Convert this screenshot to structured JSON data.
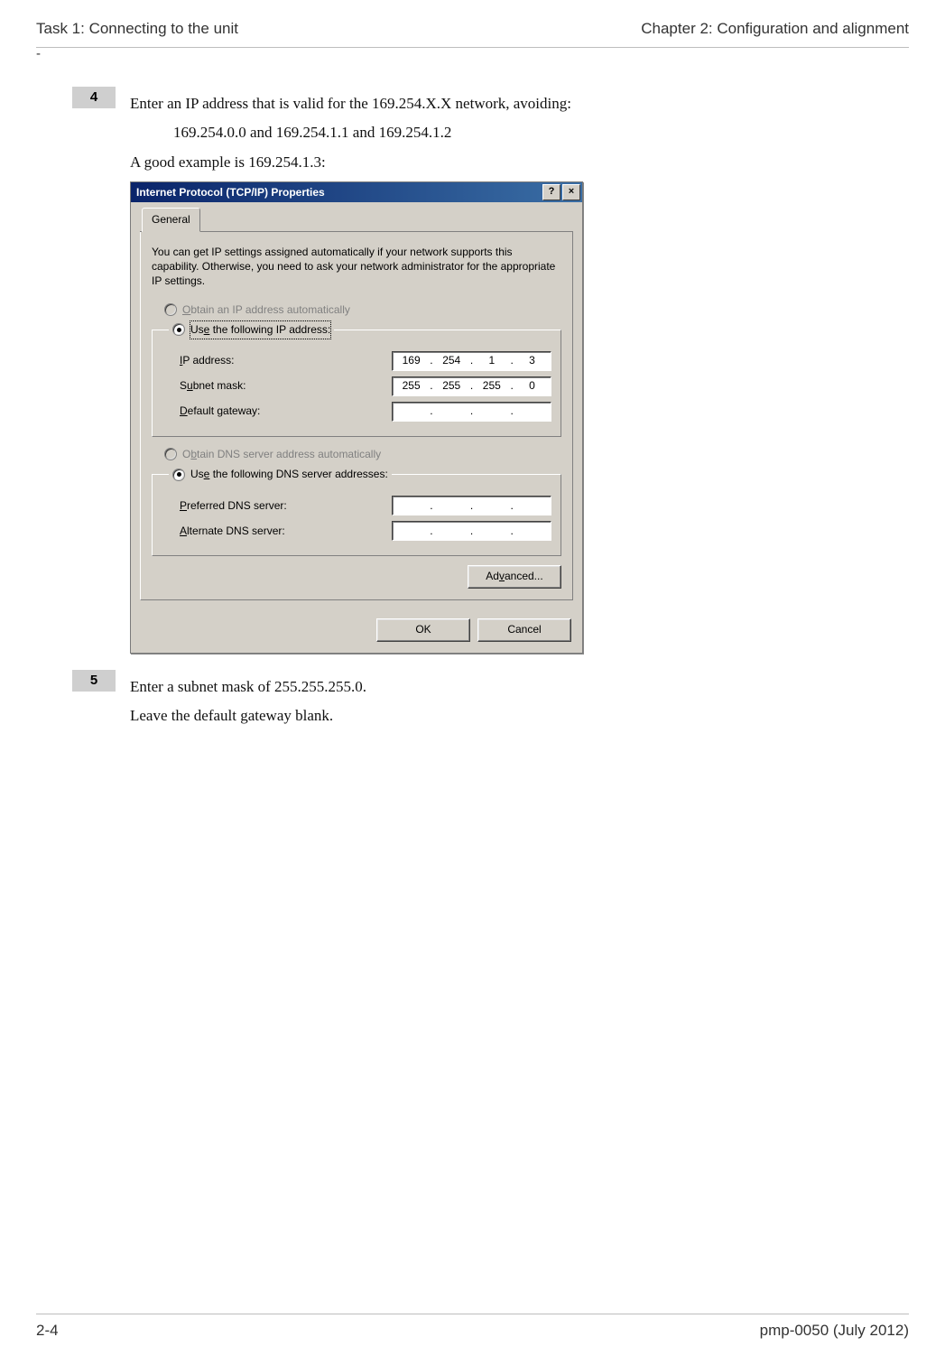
{
  "header": {
    "left": "Task 1: Connecting to the unit",
    "right": "Chapter 2:  Configuration and alignment"
  },
  "dash": "-",
  "steps": {
    "s4": {
      "num": "4",
      "line1": "Enter an IP address that is valid for the 169.254.X.X network, avoiding:",
      "indent1": "169.254.0.0 and 169.254.1.1 and 169.254.1.2",
      "line2": "A good example is 169.254.1.3:"
    },
    "s5": {
      "num": "5",
      "line1": "Enter a subnet mask of 255.255.255.0.",
      "line2": "Leave the default gateway blank."
    }
  },
  "dialog": {
    "title": "Internet Protocol (TCP/IP) Properties",
    "help_btn": "?",
    "close_btn": "×",
    "tab_general": "General",
    "info": "You can get IP settings assigned automatically if your network supports this capability. Otherwise, you need to ask your network administrator for the appropriate IP settings.",
    "radio_auto_ip_pre": "O",
    "radio_auto_ip_rest": "btain an IP address automatically",
    "radio_use_ip_pre": "Us",
    "radio_use_ip_u": "e",
    "radio_use_ip_rest": " the following IP address:",
    "lbl_ip_u": "I",
    "lbl_ip_rest": "P address:",
    "lbl_subnet_pre": "S",
    "lbl_subnet_u": "u",
    "lbl_subnet_rest": "bnet mask:",
    "lbl_gw_u": "D",
    "lbl_gw_rest": "efault gateway:",
    "radio_auto_dns_pre": "O",
    "radio_auto_dns_u": "b",
    "radio_auto_dns_rest": "tain DNS server address automatically",
    "radio_use_dns_pre": "Us",
    "radio_use_dns_u": "e",
    "radio_use_dns_rest": " the following DNS server addresses:",
    "lbl_pdns_u": "P",
    "lbl_pdns_rest": "referred DNS server:",
    "lbl_adns_u": "A",
    "lbl_adns_rest": "lternate DNS server:",
    "ip": {
      "o1": "169",
      "o2": "254",
      "o3": "1",
      "o4": "3"
    },
    "mask": {
      "o1": "255",
      "o2": "255",
      "o3": "255",
      "o4": "0"
    },
    "gw": {
      "o1": "",
      "o2": "",
      "o3": "",
      "o4": ""
    },
    "pdns": {
      "o1": "",
      "o2": "",
      "o3": "",
      "o4": ""
    },
    "adns": {
      "o1": "",
      "o2": "",
      "o3": "",
      "o4": ""
    },
    "dot": ".",
    "adv_pre": "Ad",
    "adv_u": "v",
    "adv_rest": "anced...",
    "ok": "OK",
    "cancel": "Cancel"
  },
  "footer": {
    "left": "2-4",
    "right": "pmp-0050 (July 2012)"
  }
}
